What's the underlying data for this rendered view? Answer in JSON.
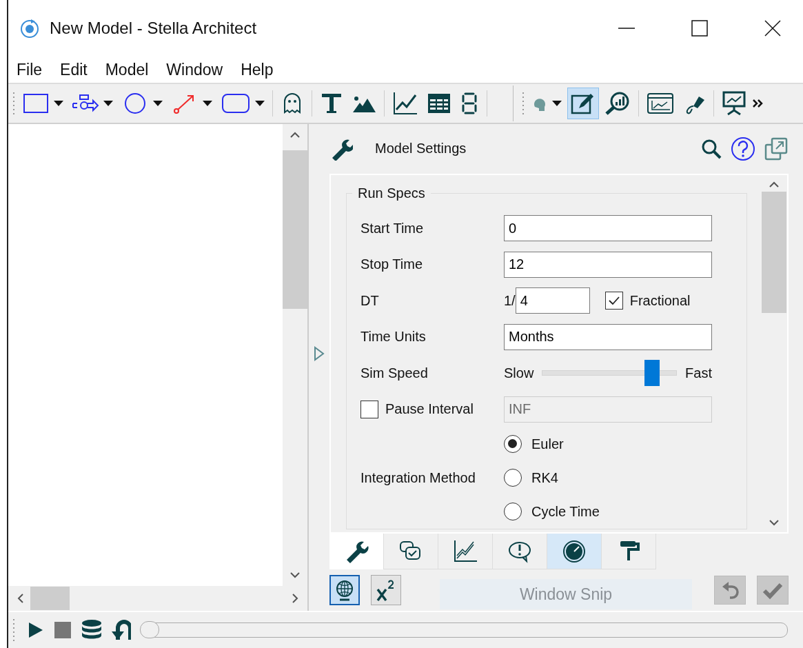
{
  "window": {
    "title": "New Model - Stella Architect"
  },
  "menu": [
    "File",
    "Edit",
    "Model",
    "Window",
    "Help"
  ],
  "toolbar": [
    {
      "selected": false
    },
    {
      "selected": false
    },
    {
      "selected": false
    },
    {
      "selected": false
    },
    {
      "selected": false
    },
    {
      "selected": false
    },
    {
      "selected": false
    },
    {
      "selected": false
    },
    {
      "selected": false
    },
    {
      "selected": false
    },
    {
      "selected": false
    },
    {
      "selected": false
    },
    {
      "selected": true
    },
    {
      "selected": false
    },
    {
      "selected": false
    },
    {
      "selected": false
    },
    {
      "selected": false
    }
  ],
  "panel": {
    "title": "Model Settings",
    "group": "Run Specs",
    "fields": [
      {
        "label": "Start Time",
        "value": "0"
      },
      {
        "label": "Stop Time",
        "value": "12"
      }
    ],
    "dt": {
      "label": "DT",
      "prefix": "1/",
      "value": "4",
      "fractional": {
        "label": "Fractional",
        "checked": true
      }
    },
    "time_units": {
      "label": "Time Units",
      "value": "Months"
    },
    "sim_speed": {
      "label": "Sim Speed",
      "min_label": "Slow",
      "max_label": "Fast",
      "level": 0.82
    },
    "pause_interval": {
      "label": "Pause Interval",
      "checked": false,
      "value": "INF",
      "disabled": true
    },
    "integration": {
      "label": "Integration Method",
      "options": [
        {
          "label": "Euler",
          "selected": true
        },
        {
          "label": "RK4",
          "selected": false
        },
        {
          "label": "Cycle Time",
          "selected": false
        }
      ]
    },
    "tabs": [
      {
        "selected": true,
        "highlighted": false
      },
      {
        "selected": false,
        "highlighted": false
      },
      {
        "selected": false,
        "highlighted": false
      },
      {
        "selected": false,
        "highlighted": false
      },
      {
        "selected": false,
        "highlighted": true
      },
      {
        "selected": false,
        "highlighted": false
      }
    ],
    "bottom_buttons": [
      {
        "selected": true
      },
      {
        "selected": false
      }
    ],
    "tooltip": "Window Snip"
  }
}
